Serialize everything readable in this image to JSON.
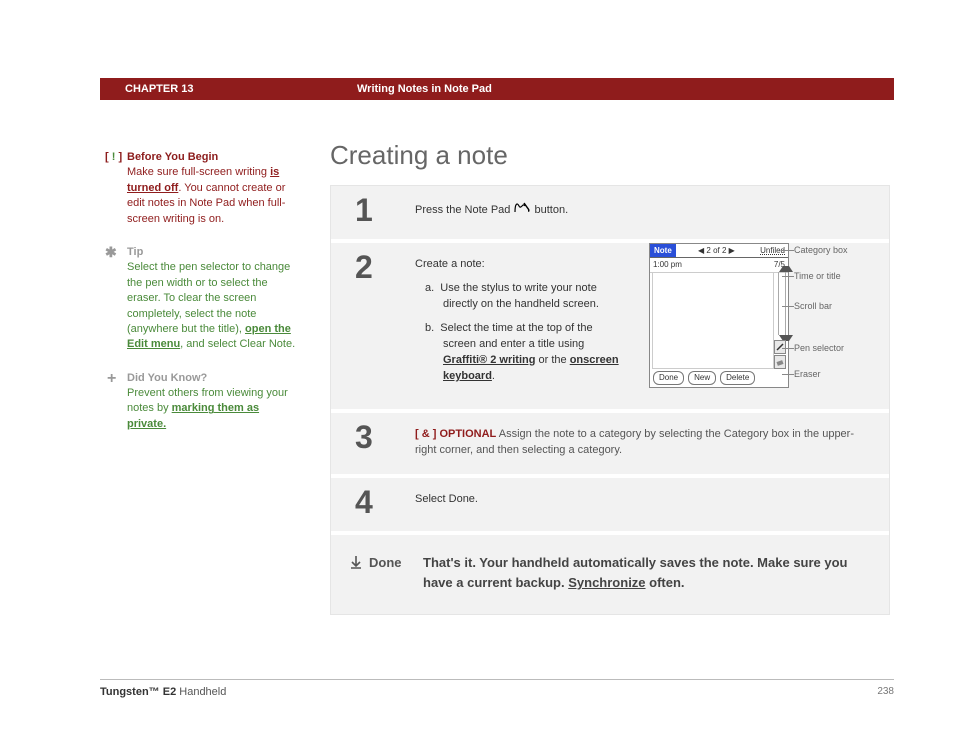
{
  "header": {
    "chapter": "CHAPTER 13",
    "title": "Writing Notes in Note Pad"
  },
  "sidebar": {
    "before": {
      "icon_open": "[ ",
      "icon_bang": "!",
      "icon_close": " ]",
      "head": "Before You Begin",
      "body_a": "Make sure full-screen writing ",
      "link": "is turned off",
      "body_b": ". You cannot create or edit notes in Note Pad when full-screen writing is on."
    },
    "tip": {
      "head": "Tip",
      "body_a": "Select the pen selector to change the pen width or to select the eraser. To clear the screen completely, select the note (anywhere but the title), ",
      "link": "open the Edit menu",
      "body_b": ", and select Clear Note."
    },
    "dyk": {
      "head": "Did You Know?",
      "body_a": "Prevent others from viewing your notes by ",
      "link": "marking them as private."
    }
  },
  "main_title": "Creating a note",
  "steps": {
    "s1": {
      "num": "1",
      "text_a": "Press the Note Pad ",
      "text_b": " button."
    },
    "s2": {
      "num": "2",
      "intro": "Create a note:",
      "a": "Use the stylus to write your note directly on the handheld screen.",
      "b_a": "Select the time at the top of the screen and enter a title using ",
      "b_link1": "Graffiti® 2 writing",
      "b_mid": " or the ",
      "b_link2": "onscreen keyboard",
      "b_end": "."
    },
    "s3": {
      "num": "3",
      "tag": "[ & ]  OPTIONAL",
      "text": "   Assign the note to a category by selecting the Category box in the upper-right corner, and then selecting a category."
    },
    "s4": {
      "num": "4",
      "text": "Select Done."
    },
    "done": {
      "label": "Done",
      "text_a": "That's it. Your handheld automatically saves the note. Make sure you have a current backup. ",
      "sync": "Synchronize",
      "text_b": " often."
    }
  },
  "device": {
    "tab": "Note",
    "nav": "◀  2 of 2  ▶",
    "category": "Unfiled",
    "time": "1:00 pm",
    "date": "7/5",
    "btn_done": "Done",
    "btn_new": "New",
    "btn_delete": "Delete"
  },
  "callouts": {
    "cat": "Category box",
    "time": "Time or title",
    "scroll": "Scroll bar",
    "pen": "Pen selector",
    "eraser": "Eraser"
  },
  "footer": {
    "product_bold": "Tungsten™ E2",
    "product_rest": " Handheld",
    "page": "238"
  }
}
